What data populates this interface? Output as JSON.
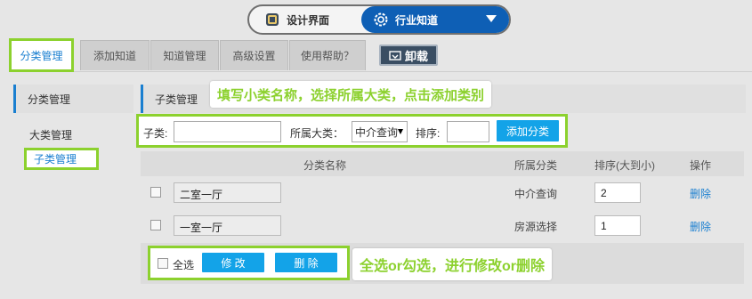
{
  "toggle": {
    "left_label": "设计界面",
    "right_label": "行业知道"
  },
  "tabs": [
    {
      "label": "分类管理",
      "active": true
    },
    {
      "label": "添加知道",
      "active": false
    },
    {
      "label": "知道管理",
      "active": false
    },
    {
      "label": "高级设置",
      "active": false
    },
    {
      "label": "使用帮助？",
      "active": false
    }
  ],
  "uninstall_label": "卸载",
  "sidebar": {
    "header": "分类管理",
    "items": [
      {
        "label": "大类管理",
        "active": false
      },
      {
        "label": "子类管理",
        "active": true
      }
    ]
  },
  "main": {
    "header": "子类管理",
    "callout_top": "填写小类名称，选择所属大类，点击添加类别",
    "callout_bottom": "全选or勾选，进行修改or删除",
    "form": {
      "subcat_label": "子类:",
      "subcat_value": "",
      "parent_label": "所属大类：",
      "parent_selected": "中介查询",
      "sort_label": "排序:",
      "sort_value": "",
      "add_button": "添加分类"
    },
    "table": {
      "headers": [
        "分类名称",
        "所属分类",
        "排序(大到小)",
        "操作"
      ],
      "rows": [
        {
          "name": "二室一厅",
          "category": "中介查询",
          "sort": "2",
          "action": "删除"
        },
        {
          "name": "一室一厅",
          "category": "房源选择",
          "sort": "1",
          "action": "删除"
        }
      ]
    },
    "bulk": {
      "select_all": "全选",
      "edit_button": "修 改",
      "delete_button": "删 除"
    }
  },
  "colors": {
    "accent_blue": "#1a7fd0",
    "highlight_green": "#8cd12e",
    "button_blue": "#13a3e8",
    "toggle_blue": "#0e5fb5"
  }
}
